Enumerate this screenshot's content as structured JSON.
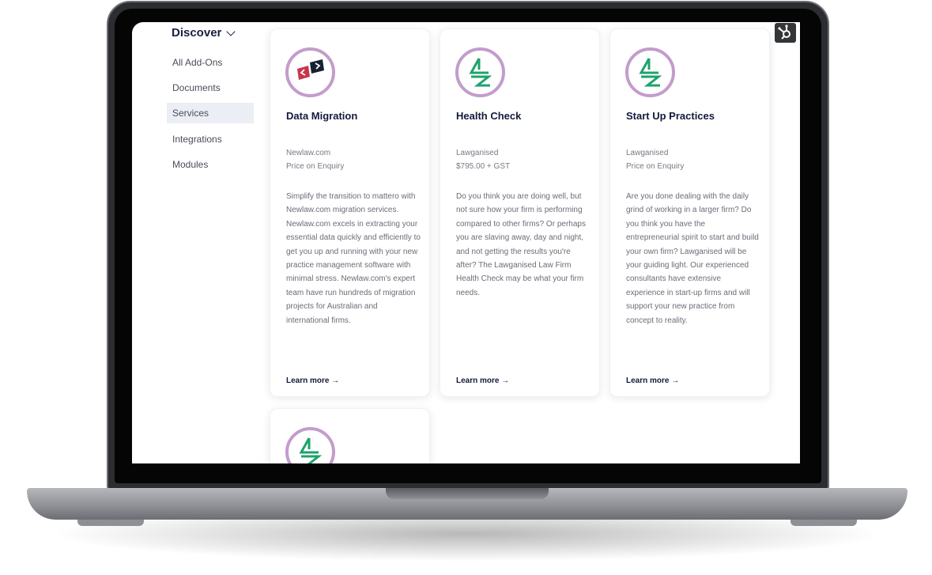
{
  "sidebar": {
    "title": "Discover",
    "items": [
      {
        "label": "All Add-Ons"
      },
      {
        "label": "Documents"
      },
      {
        "label": "Services"
      },
      {
        "label": "Integrations"
      },
      {
        "label": "Modules"
      }
    ],
    "active_index": 2
  },
  "cards": [
    {
      "title": "Data Migration",
      "vendor": "Newlaw.com",
      "price": "Price on Enquiry",
      "description": "Simplify the transition to mattero with Newlaw.com migration services. Newlaw.com excels in extracting your essential data quickly and efficiently to get you up and running with your new practice management software with minimal stress. Newlaw.com's expert team have run hundreds of migration projects for Australian and international firms.",
      "learn_more": "Learn more →",
      "icon": "code-arrows-icon"
    },
    {
      "title": "Health Check",
      "vendor": "Lawganised",
      "price": "$795.00 + GST",
      "description": "Do you think you are doing well, but not sure how your firm is performing compared to other firms? Or perhaps you are slaving away, day and night, and not getting the results you're after? The Lawganised Law Firm Health Check may be what your firm needs.",
      "learn_more": "Learn more →",
      "icon": "lawganised-logo-icon"
    },
    {
      "title": "Start Up Practices",
      "vendor": "Lawganised",
      "price": "Price on Enquiry",
      "description": "Are you done dealing with the daily grind of working in a larger firm? Do you think you have the entrepreneurial spirit to start and build your own firm? Lawganised will be your guiding light. Our experienced consultants have extensive experience in start-up firms and will support your new practice from concept to reality.",
      "learn_more": "Learn more →",
      "icon": "lawganised-logo-icon"
    },
    {
      "icon": "lawganised-logo-icon"
    }
  ],
  "colors": {
    "navy": "#141a3d",
    "ring": "#c39ccc",
    "green": "#1ea36b",
    "red": "#c8354a",
    "active_bg": "#eceef5"
  },
  "hubspot_icon": "hubspot-sprocket-icon"
}
